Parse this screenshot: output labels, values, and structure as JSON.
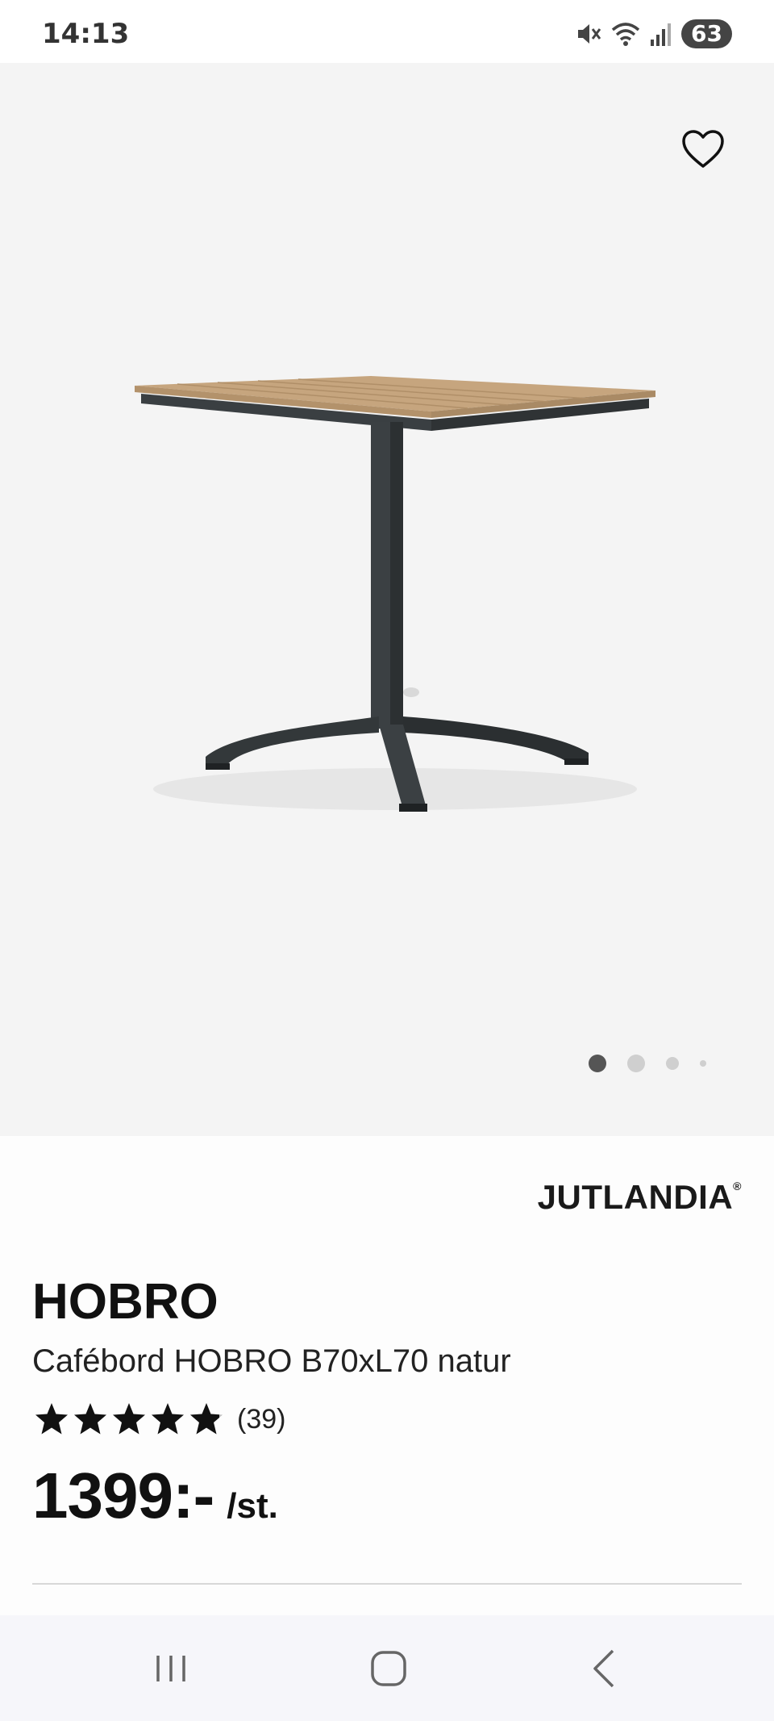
{
  "status_bar": {
    "time": "14:13",
    "battery": "63",
    "icons": [
      "mute-icon",
      "wifi-icon",
      "signal-icon",
      "battery-icon"
    ]
  },
  "gallery": {
    "total_images": 4,
    "active_index": 0,
    "favorite_icon": "heart-outline-icon"
  },
  "product": {
    "brand": "JUTLANDIA",
    "brand_mark": "®",
    "name": "HOBRO",
    "description": "Cafébord HOBRO B70xL70 natur",
    "rating_stars": 4.8,
    "rating_max": 5,
    "rating_count": "(39)",
    "price": "1399:-",
    "price_unit": "/st."
  },
  "nav_bar": {
    "icons": [
      "recent-apps-icon",
      "home-icon",
      "back-icon"
    ]
  },
  "colors": {
    "image_bg": "#f4f4f4",
    "text": "#111111",
    "dot_active": "#555555",
    "dot_inactive": "#cfcfcf"
  }
}
